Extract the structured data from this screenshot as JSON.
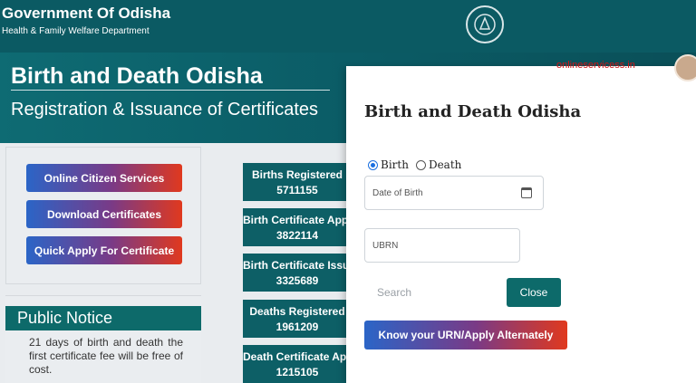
{
  "header": {
    "title": "Government Of Odisha",
    "subtitle": "Health & Family Welfare Department",
    "emblem_icon": "state-emblem-icon"
  },
  "banner": {
    "title": "Birth and Death Odisha",
    "subtitle": "Registration & Issuance of Certificates"
  },
  "sidebar": {
    "buttons": [
      {
        "label": "Online Citizen Services"
      },
      {
        "label": "Download Certificates"
      },
      {
        "label": "Quick Apply For Certificate"
      }
    ]
  },
  "notice": {
    "heading": "Public Notice",
    "text": "21 days of birth and death the first certificate fee will be free of cost."
  },
  "stats": [
    {
      "label": "Births Registered",
      "value": "5711155"
    },
    {
      "label": "Birth Certificate Applied",
      "value": "3822114"
    },
    {
      "label": "Birth Certificate Issued",
      "value": "3325689"
    },
    {
      "label": "Deaths Registered",
      "value": "1961209"
    },
    {
      "label": "Death Certificate Applied",
      "value": "1215105"
    }
  ],
  "modal": {
    "title": "Birth and Death Odisha",
    "radio_birth": "Birth",
    "radio_death": "Death",
    "selected": "Birth",
    "date_placeholder": "Date of Birth",
    "ubrn_placeholder": "UBRN",
    "search_label": "Search",
    "close_label": "Close",
    "know_label": "Know your URN/Apply Alternately"
  },
  "watermark": "onlineservicess.in",
  "colors": {
    "primary": "#0b5a63",
    "accent_red": "#e0391e",
    "accent_blue": "#2b65c7"
  }
}
